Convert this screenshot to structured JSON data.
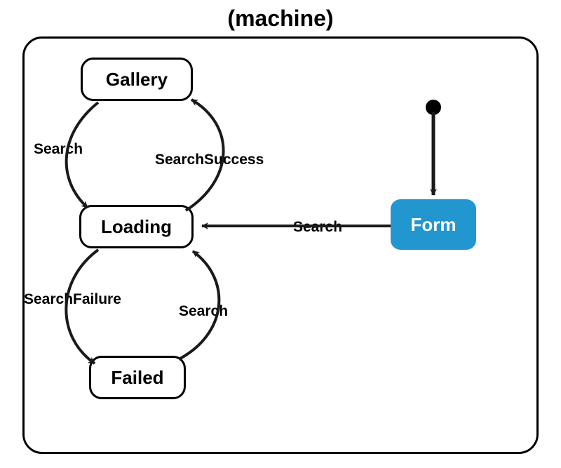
{
  "title": "(machine)",
  "states": {
    "gallery": "Gallery",
    "loading": "Loading",
    "failed": "Failed",
    "form": "Form"
  },
  "transitions": {
    "gallery_to_loading": "Search",
    "loading_to_gallery": "SearchSuccess",
    "loading_to_failed": "SearchFailure",
    "failed_to_loading": "Search",
    "form_to_loading": "Search"
  },
  "initial_state": "form",
  "colors": {
    "initial_fill": "#2196cf",
    "border": "#000000",
    "arrow": "#1a1a1a"
  }
}
